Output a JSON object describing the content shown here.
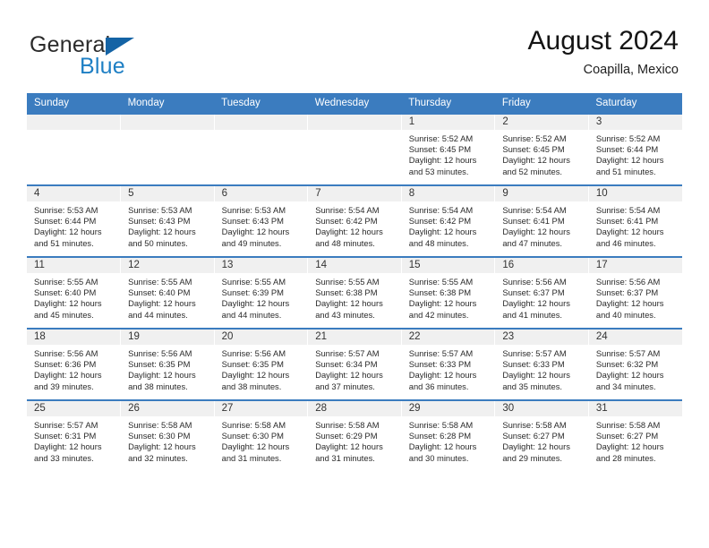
{
  "brand": {
    "name_part1": "General",
    "name_part2": "Blue",
    "triangle_color": "#1463a5",
    "blue_color": "#1e7fc4"
  },
  "header": {
    "title": "August 2024",
    "location": "Coapilla, Mexico"
  },
  "theme": {
    "header_row_bg": "#3b7cbf",
    "day_band_bg": "#f0f0f0",
    "row_border": "#3b7cbf"
  },
  "weekdays": [
    "Sunday",
    "Monday",
    "Tuesday",
    "Wednesday",
    "Thursday",
    "Friday",
    "Saturday"
  ],
  "labels": {
    "sunrise_prefix": "Sunrise:",
    "sunset_prefix": "Sunset:",
    "daylight_prefix": "Daylight:"
  },
  "weeks": [
    [
      {
        "day": "",
        "empty": true
      },
      {
        "day": "",
        "empty": true
      },
      {
        "day": "",
        "empty": true
      },
      {
        "day": "",
        "empty": true
      },
      {
        "day": "1",
        "sunrise": "Sunrise: 5:52 AM",
        "sunset": "Sunset: 6:45 PM",
        "daylight_line1": "Daylight: 12 hours",
        "daylight_line2": "and 53 minutes."
      },
      {
        "day": "2",
        "sunrise": "Sunrise: 5:52 AM",
        "sunset": "Sunset: 6:45 PM",
        "daylight_line1": "Daylight: 12 hours",
        "daylight_line2": "and 52 minutes."
      },
      {
        "day": "3",
        "sunrise": "Sunrise: 5:52 AM",
        "sunset": "Sunset: 6:44 PM",
        "daylight_line1": "Daylight: 12 hours",
        "daylight_line2": "and 51 minutes."
      }
    ],
    [
      {
        "day": "4",
        "sunrise": "Sunrise: 5:53 AM",
        "sunset": "Sunset: 6:44 PM",
        "daylight_line1": "Daylight: 12 hours",
        "daylight_line2": "and 51 minutes."
      },
      {
        "day": "5",
        "sunrise": "Sunrise: 5:53 AM",
        "sunset": "Sunset: 6:43 PM",
        "daylight_line1": "Daylight: 12 hours",
        "daylight_line2": "and 50 minutes."
      },
      {
        "day": "6",
        "sunrise": "Sunrise: 5:53 AM",
        "sunset": "Sunset: 6:43 PM",
        "daylight_line1": "Daylight: 12 hours",
        "daylight_line2": "and 49 minutes."
      },
      {
        "day": "7",
        "sunrise": "Sunrise: 5:54 AM",
        "sunset": "Sunset: 6:42 PM",
        "daylight_line1": "Daylight: 12 hours",
        "daylight_line2": "and 48 minutes."
      },
      {
        "day": "8",
        "sunrise": "Sunrise: 5:54 AM",
        "sunset": "Sunset: 6:42 PM",
        "daylight_line1": "Daylight: 12 hours",
        "daylight_line2": "and 48 minutes."
      },
      {
        "day": "9",
        "sunrise": "Sunrise: 5:54 AM",
        "sunset": "Sunset: 6:41 PM",
        "daylight_line1": "Daylight: 12 hours",
        "daylight_line2": "and 47 minutes."
      },
      {
        "day": "10",
        "sunrise": "Sunrise: 5:54 AM",
        "sunset": "Sunset: 6:41 PM",
        "daylight_line1": "Daylight: 12 hours",
        "daylight_line2": "and 46 minutes."
      }
    ],
    [
      {
        "day": "11",
        "sunrise": "Sunrise: 5:55 AM",
        "sunset": "Sunset: 6:40 PM",
        "daylight_line1": "Daylight: 12 hours",
        "daylight_line2": "and 45 minutes."
      },
      {
        "day": "12",
        "sunrise": "Sunrise: 5:55 AM",
        "sunset": "Sunset: 6:40 PM",
        "daylight_line1": "Daylight: 12 hours",
        "daylight_line2": "and 44 minutes."
      },
      {
        "day": "13",
        "sunrise": "Sunrise: 5:55 AM",
        "sunset": "Sunset: 6:39 PM",
        "daylight_line1": "Daylight: 12 hours",
        "daylight_line2": "and 44 minutes."
      },
      {
        "day": "14",
        "sunrise": "Sunrise: 5:55 AM",
        "sunset": "Sunset: 6:38 PM",
        "daylight_line1": "Daylight: 12 hours",
        "daylight_line2": "and 43 minutes."
      },
      {
        "day": "15",
        "sunrise": "Sunrise: 5:55 AM",
        "sunset": "Sunset: 6:38 PM",
        "daylight_line1": "Daylight: 12 hours",
        "daylight_line2": "and 42 minutes."
      },
      {
        "day": "16",
        "sunrise": "Sunrise: 5:56 AM",
        "sunset": "Sunset: 6:37 PM",
        "daylight_line1": "Daylight: 12 hours",
        "daylight_line2": "and 41 minutes."
      },
      {
        "day": "17",
        "sunrise": "Sunrise: 5:56 AM",
        "sunset": "Sunset: 6:37 PM",
        "daylight_line1": "Daylight: 12 hours",
        "daylight_line2": "and 40 minutes."
      }
    ],
    [
      {
        "day": "18",
        "sunrise": "Sunrise: 5:56 AM",
        "sunset": "Sunset: 6:36 PM",
        "daylight_line1": "Daylight: 12 hours",
        "daylight_line2": "and 39 minutes."
      },
      {
        "day": "19",
        "sunrise": "Sunrise: 5:56 AM",
        "sunset": "Sunset: 6:35 PM",
        "daylight_line1": "Daylight: 12 hours",
        "daylight_line2": "and 38 minutes."
      },
      {
        "day": "20",
        "sunrise": "Sunrise: 5:56 AM",
        "sunset": "Sunset: 6:35 PM",
        "daylight_line1": "Daylight: 12 hours",
        "daylight_line2": "and 38 minutes."
      },
      {
        "day": "21",
        "sunrise": "Sunrise: 5:57 AM",
        "sunset": "Sunset: 6:34 PM",
        "daylight_line1": "Daylight: 12 hours",
        "daylight_line2": "and 37 minutes."
      },
      {
        "day": "22",
        "sunrise": "Sunrise: 5:57 AM",
        "sunset": "Sunset: 6:33 PM",
        "daylight_line1": "Daylight: 12 hours",
        "daylight_line2": "and 36 minutes."
      },
      {
        "day": "23",
        "sunrise": "Sunrise: 5:57 AM",
        "sunset": "Sunset: 6:33 PM",
        "daylight_line1": "Daylight: 12 hours",
        "daylight_line2": "and 35 minutes."
      },
      {
        "day": "24",
        "sunrise": "Sunrise: 5:57 AM",
        "sunset": "Sunset: 6:32 PM",
        "daylight_line1": "Daylight: 12 hours",
        "daylight_line2": "and 34 minutes."
      }
    ],
    [
      {
        "day": "25",
        "sunrise": "Sunrise: 5:57 AM",
        "sunset": "Sunset: 6:31 PM",
        "daylight_line1": "Daylight: 12 hours",
        "daylight_line2": "and 33 minutes."
      },
      {
        "day": "26",
        "sunrise": "Sunrise: 5:58 AM",
        "sunset": "Sunset: 6:30 PM",
        "daylight_line1": "Daylight: 12 hours",
        "daylight_line2": "and 32 minutes."
      },
      {
        "day": "27",
        "sunrise": "Sunrise: 5:58 AM",
        "sunset": "Sunset: 6:30 PM",
        "daylight_line1": "Daylight: 12 hours",
        "daylight_line2": "and 31 minutes."
      },
      {
        "day": "28",
        "sunrise": "Sunrise: 5:58 AM",
        "sunset": "Sunset: 6:29 PM",
        "daylight_line1": "Daylight: 12 hours",
        "daylight_line2": "and 31 minutes."
      },
      {
        "day": "29",
        "sunrise": "Sunrise: 5:58 AM",
        "sunset": "Sunset: 6:28 PM",
        "daylight_line1": "Daylight: 12 hours",
        "daylight_line2": "and 30 minutes."
      },
      {
        "day": "30",
        "sunrise": "Sunrise: 5:58 AM",
        "sunset": "Sunset: 6:27 PM",
        "daylight_line1": "Daylight: 12 hours",
        "daylight_line2": "and 29 minutes."
      },
      {
        "day": "31",
        "sunrise": "Sunrise: 5:58 AM",
        "sunset": "Sunset: 6:27 PM",
        "daylight_line1": "Daylight: 12 hours",
        "daylight_line2": "and 28 minutes."
      }
    ]
  ]
}
